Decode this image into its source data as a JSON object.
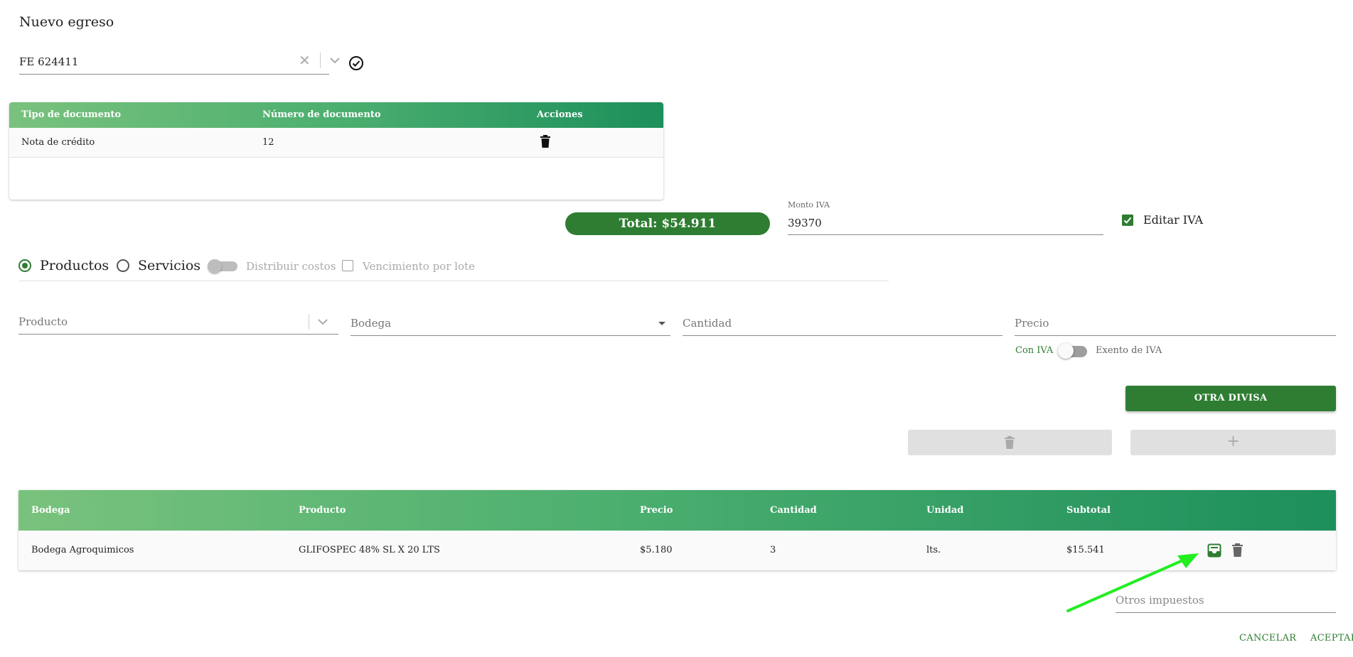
{
  "page": {
    "title": "Nuevo egreso"
  },
  "document_select": {
    "value": "FE 624411",
    "clear_symbol": "✕"
  },
  "doc_table": {
    "headers": [
      "Tipo de documento",
      "Número de documento",
      "Acciones"
    ],
    "rows": [
      {
        "tipo": "Nota de crédito",
        "numero": "12"
      }
    ]
  },
  "totals": {
    "total_label": "Total: $54.911",
    "iva_label": "Monto IVA",
    "iva_value": "39370",
    "edit_iva_label": "Editar IVA",
    "edit_iva_checked": true
  },
  "mode": {
    "productos_label": "Productos",
    "servicios_label": "Servicios",
    "selected": "Productos",
    "distribuir_label": "Distribuir costos",
    "vencimiento_label": "Vencimiento por lote"
  },
  "item_form": {
    "producto_placeholder": "Producto",
    "bodega_placeholder": "Bodega",
    "cantidad_placeholder": "Cantidad",
    "precio_placeholder": "Precio",
    "con_iva_label": "Con IVA",
    "exento_label": "Exento de IVA",
    "otra_divisa_label": "OTRA DIVISA",
    "add_symbol": "+"
  },
  "items_table": {
    "headers": [
      "Bodega",
      "Producto",
      "Precio",
      "Cantidad",
      "Unidad",
      "Subtotal"
    ],
    "rows": [
      {
        "bodega": "Bodega Agroquimicos",
        "producto": "GLIFOSPEC 48% SL X 20 LTS",
        "precio": "$5.180",
        "cantidad": "3",
        "unidad": "lts.",
        "subtotal": "$15.541"
      }
    ]
  },
  "otros_impuestos_placeholder": "Otros impuestos",
  "actions": {
    "cancel_label": "CANCELAR",
    "accept_label": "ACEPTAR"
  },
  "colors": {
    "primary": "#2e7d32",
    "header_gradient_start": "#79c27d",
    "header_gradient_end": "#1d8f5b",
    "annotation_arrow": "#22ee22"
  },
  "icons": [
    "close-icon",
    "chevron-down-icon",
    "check-circle-icon",
    "trash-icon",
    "inbox-icon",
    "plus-icon",
    "caret-down-icon"
  ]
}
